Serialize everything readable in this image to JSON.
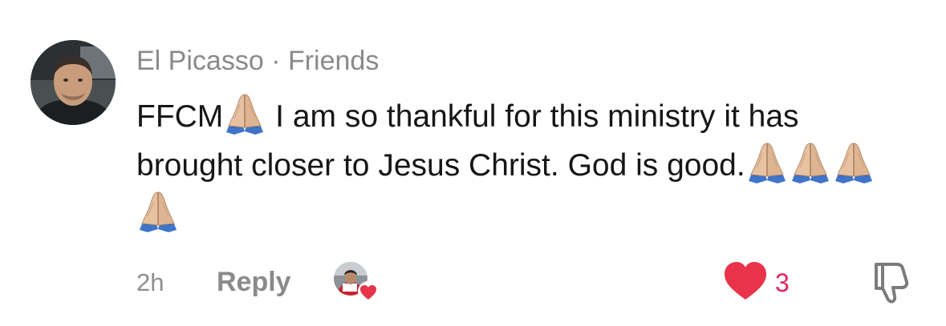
{
  "comment": {
    "author": "El Picasso",
    "separator": " · ",
    "relationship": "Friends",
    "text_segments": [
      "FFCM",
      " I am so thankful for this ministry it has brought closer to Jesus Christ. God is good."
    ],
    "emoji": "folded-hands",
    "timestamp": "2h",
    "reply_label": "Reply",
    "like_count": "3",
    "liked": true
  },
  "icons": {
    "like": "heart-icon",
    "dislike": "thumbs-down-icon",
    "emoji": "folded-hands-icon"
  },
  "colors": {
    "like": "#e8334a",
    "like_count_text": "#e0245e",
    "meta_text": "#8a8a8a",
    "body_text": "#161616"
  }
}
